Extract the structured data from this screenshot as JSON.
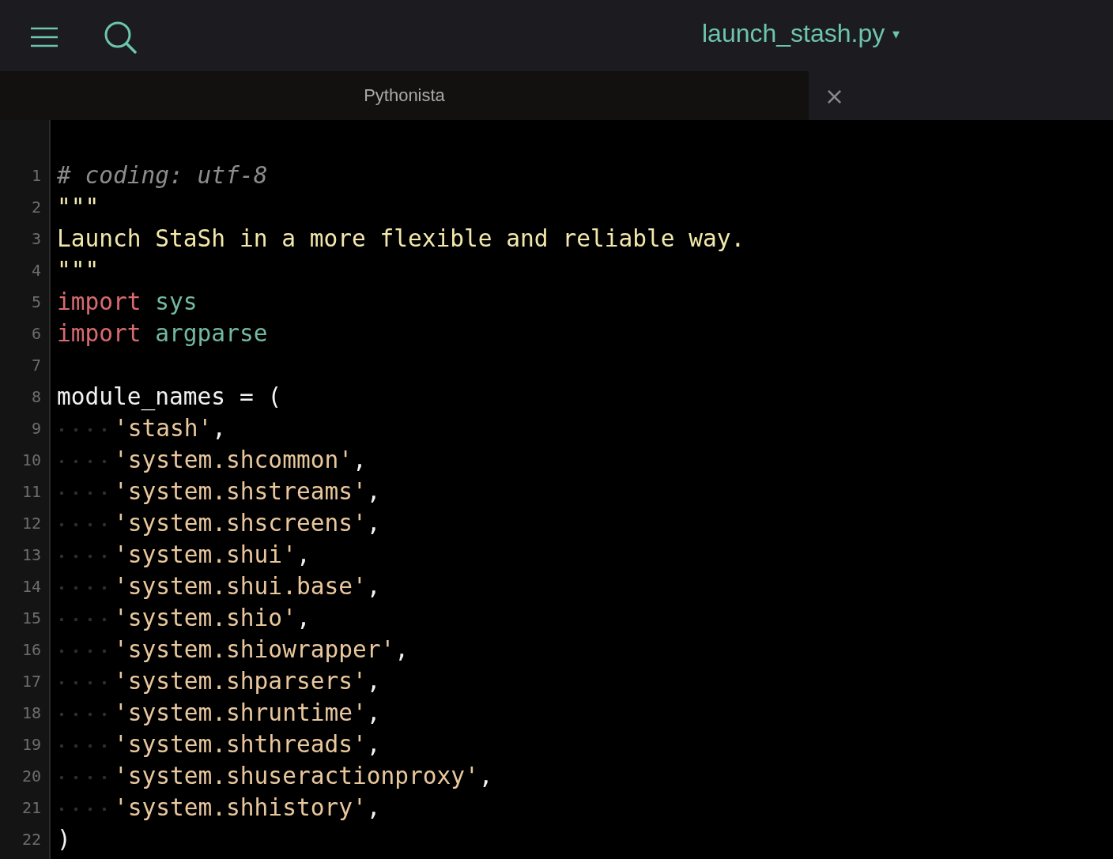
{
  "toolbar": {
    "file_name": "launch_stash.py",
    "dropdown_arrow": "▾"
  },
  "tab": {
    "label": "Pythonista",
    "close": "×"
  },
  "lines": [
    {
      "number": "1",
      "indent": false,
      "tokens": [
        {
          "kind": "comment",
          "text": "# coding: utf-8"
        }
      ]
    },
    {
      "number": "2",
      "indent": false,
      "tokens": [
        {
          "kind": "docstring",
          "text": "\"\"\""
        }
      ]
    },
    {
      "number": "3",
      "indent": false,
      "tokens": [
        {
          "kind": "docstring",
          "text": "Launch StaSh in a more flexible and reliable way."
        }
      ]
    },
    {
      "number": "4",
      "indent": false,
      "tokens": [
        {
          "kind": "docstring",
          "text": "\"\"\""
        }
      ]
    },
    {
      "number": "5",
      "indent": false,
      "tokens": [
        {
          "kind": "keyword",
          "text": "import "
        },
        {
          "kind": "module",
          "text": "sys"
        }
      ]
    },
    {
      "number": "6",
      "indent": false,
      "tokens": [
        {
          "kind": "keyword",
          "text": "import "
        },
        {
          "kind": "module",
          "text": "argparse"
        }
      ]
    },
    {
      "number": "7",
      "indent": false
    },
    {
      "number": "8",
      "indent": false,
      "tokens": [
        {
          "kind": "plain",
          "text": "module_names = ("
        }
      ]
    },
    {
      "number": "9",
      "indent": true,
      "tokens": [
        {
          "kind": "string",
          "text": "'stash'"
        },
        {
          "kind": "plain",
          "text": ","
        }
      ]
    },
    {
      "number": "10",
      "indent": true,
      "tokens": [
        {
          "kind": "string",
          "text": "'system.shcommon'"
        },
        {
          "kind": "plain",
          "text": ","
        }
      ]
    },
    {
      "number": "11",
      "indent": true,
      "tokens": [
        {
          "kind": "string",
          "text": "'system.shstreams'"
        },
        {
          "kind": "plain",
          "text": ","
        }
      ]
    },
    {
      "number": "12",
      "indent": true,
      "tokens": [
        {
          "kind": "string",
          "text": "'system.shscreens'"
        },
        {
          "kind": "plain",
          "text": ","
        }
      ]
    },
    {
      "number": "13",
      "indent": true,
      "tokens": [
        {
          "kind": "string",
          "text": "'system.shui'"
        },
        {
          "kind": "plain",
          "text": ","
        }
      ]
    },
    {
      "number": "14",
      "indent": true,
      "tokens": [
        {
          "kind": "string",
          "text": "'system.shui.base'"
        },
        {
          "kind": "plain",
          "text": ","
        }
      ]
    },
    {
      "number": "15",
      "indent": true,
      "tokens": [
        {
          "kind": "string",
          "text": "'system.shio'"
        },
        {
          "kind": "plain",
          "text": ","
        }
      ]
    },
    {
      "number": "16",
      "indent": true,
      "tokens": [
        {
          "kind": "string",
          "text": "'system.shiowrapper'"
        },
        {
          "kind": "plain",
          "text": ","
        }
      ]
    },
    {
      "number": "17",
      "indent": true,
      "tokens": [
        {
          "kind": "string",
          "text": "'system.shparsers'"
        },
        {
          "kind": "plain",
          "text": ","
        }
      ]
    },
    {
      "number": "18",
      "indent": true,
      "tokens": [
        {
          "kind": "string",
          "text": "'system.shruntime'"
        },
        {
          "kind": "plain",
          "text": ","
        }
      ]
    },
    {
      "number": "19",
      "indent": true,
      "tokens": [
        {
          "kind": "string",
          "text": "'system.shthreads'"
        },
        {
          "kind": "plain",
          "text": ","
        }
      ]
    },
    {
      "number": "20",
      "indent": true,
      "tokens": [
        {
          "kind": "string",
          "text": "'system.shuseractionproxy'"
        },
        {
          "kind": "plain",
          "text": ","
        }
      ]
    },
    {
      "number": "21",
      "indent": true,
      "tokens": [
        {
          "kind": "string",
          "text": "'system.shhistory'"
        },
        {
          "kind": "plain",
          "text": ","
        }
      ]
    },
    {
      "number": "22",
      "indent": false,
      "tokens": [
        {
          "kind": "plain",
          "text": ")"
        }
      ]
    }
  ]
}
